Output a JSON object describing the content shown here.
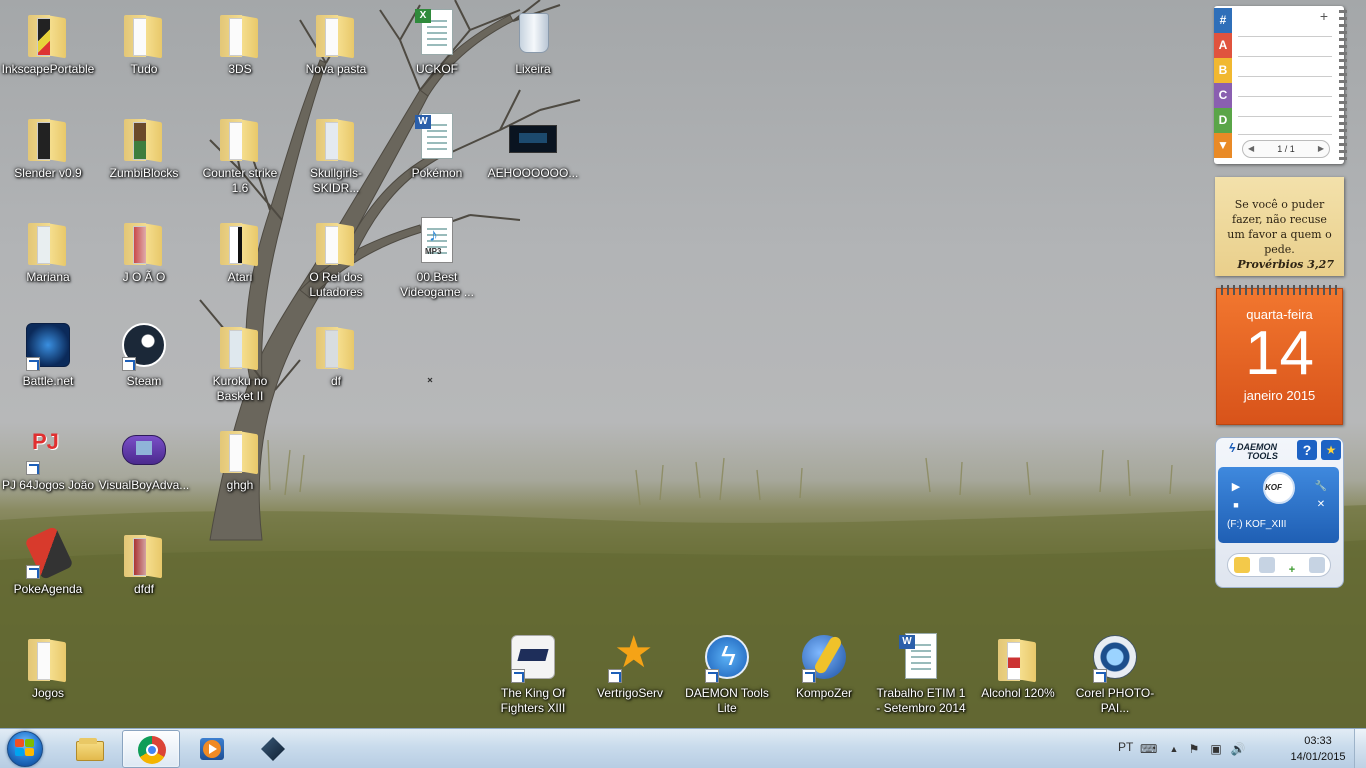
{
  "desktop_icons": [
    {
      "label": "InkscapePortable",
      "icon": "folder-icon"
    },
    {
      "label": "Tudo",
      "icon": "folder-icon"
    },
    {
      "label": "3DS",
      "icon": "folder-icon"
    },
    {
      "label": "Nova pasta",
      "icon": "folder-icon"
    },
    {
      "label": "UCKOF",
      "icon": "excel-document-icon"
    },
    {
      "label": "Lixeira",
      "icon": "recycle-bin-icon"
    },
    {
      "label": "Slender v0.9",
      "icon": "folder-icon"
    },
    {
      "label": "ZumbiBlocks",
      "icon": "folder-icon"
    },
    {
      "label": "Counter strike 1.6",
      "icon": "folder-icon"
    },
    {
      "label": "Skullgirls-SKIDR...",
      "icon": "folder-icon"
    },
    {
      "label": "Pokémon",
      "icon": "word-document-icon"
    },
    {
      "label": "AEHOOOOOO...",
      "icon": "video-thumbnail-icon"
    },
    {
      "label": "Mariana",
      "icon": "folder-icon"
    },
    {
      "label": "J O Ã O",
      "icon": "folder-icon"
    },
    {
      "label": "Atari",
      "icon": "folder-icon"
    },
    {
      "label": "O Rei dos Lutadores",
      "icon": "folder-icon"
    },
    {
      "label": "00.Best Videogame ...",
      "icon": "mp3-file-icon"
    },
    {
      "label": "Battle.net",
      "icon": "battlenet-icon"
    },
    {
      "label": "Steam",
      "icon": "steam-icon"
    },
    {
      "label": "Kuroku no Basket II",
      "icon": "folder-icon"
    },
    {
      "label": "df",
      "icon": "folder-icon"
    },
    {
      "label": "PJ 64Jogos João",
      "icon": "project64-icon"
    },
    {
      "label": "VisualBoyAdva...",
      "icon": "gameboy-advance-icon"
    },
    {
      "label": "ghgh",
      "icon": "folder-icon"
    },
    {
      "label": "PokeAgenda",
      "icon": "pokeagenda-icon"
    },
    {
      "label": "dfdf",
      "icon": "folder-icon"
    },
    {
      "label": "Jogos",
      "icon": "folder-icon"
    },
    {
      "label": "The King Of Fighters XIII",
      "icon": "kof-icon"
    },
    {
      "label": "VertrigoServ",
      "icon": "vertrigo-star-icon"
    },
    {
      "label": "DAEMON Tools Lite",
      "icon": "daemon-tools-icon"
    },
    {
      "label": "KompoZer",
      "icon": "kompozer-icon"
    },
    {
      "label": "Trabalho ETIM 1 - Setembro 2014",
      "icon": "word-document-icon"
    },
    {
      "label": "Alcohol 120%",
      "icon": "folder-icon"
    },
    {
      "label": "Corel PHOTO-PAI...",
      "icon": "corel-camera-icon"
    }
  ],
  "contacts_gadget": {
    "tabs": [
      "#",
      "A",
      "B",
      "C",
      "D",
      "▼"
    ],
    "tab_colors": [
      "#2f6fb9",
      "#e0533e",
      "#f1b830",
      "#8a5fb0",
      "#5aa548",
      "#e98a26"
    ],
    "add_label": "+",
    "pager": "1 / 1",
    "prev": "◀",
    "next": "▶"
  },
  "quote_gadget": {
    "text": "Se você o puder fazer, não recuse um favor a quem o pede.",
    "reference": "Provérbios 3,27"
  },
  "calendar_gadget": {
    "weekday": "quarta-feira",
    "day": "14",
    "month_year": "janeiro 2015"
  },
  "daemon_gadget": {
    "logo_line1": "DAEMON",
    "logo_line2": "TOOLS",
    "help": "?",
    "star": "★",
    "disc_label": "KOF",
    "drive_label": "(F:) KOF_XIII",
    "play": "▶",
    "stop": "■",
    "settings": "🔧",
    "close": "✕"
  },
  "taskbar": {
    "buttons": [
      "windows-explorer",
      "google-chrome",
      "media-player",
      "starcraft-ii"
    ],
    "tray": {
      "language": "PT",
      "time": "03:33",
      "date": "14/01/2015",
      "arrow": "▲",
      "flag": "⚑",
      "network": "▣",
      "volume": "🔊",
      "keyboard": "⌨"
    }
  }
}
